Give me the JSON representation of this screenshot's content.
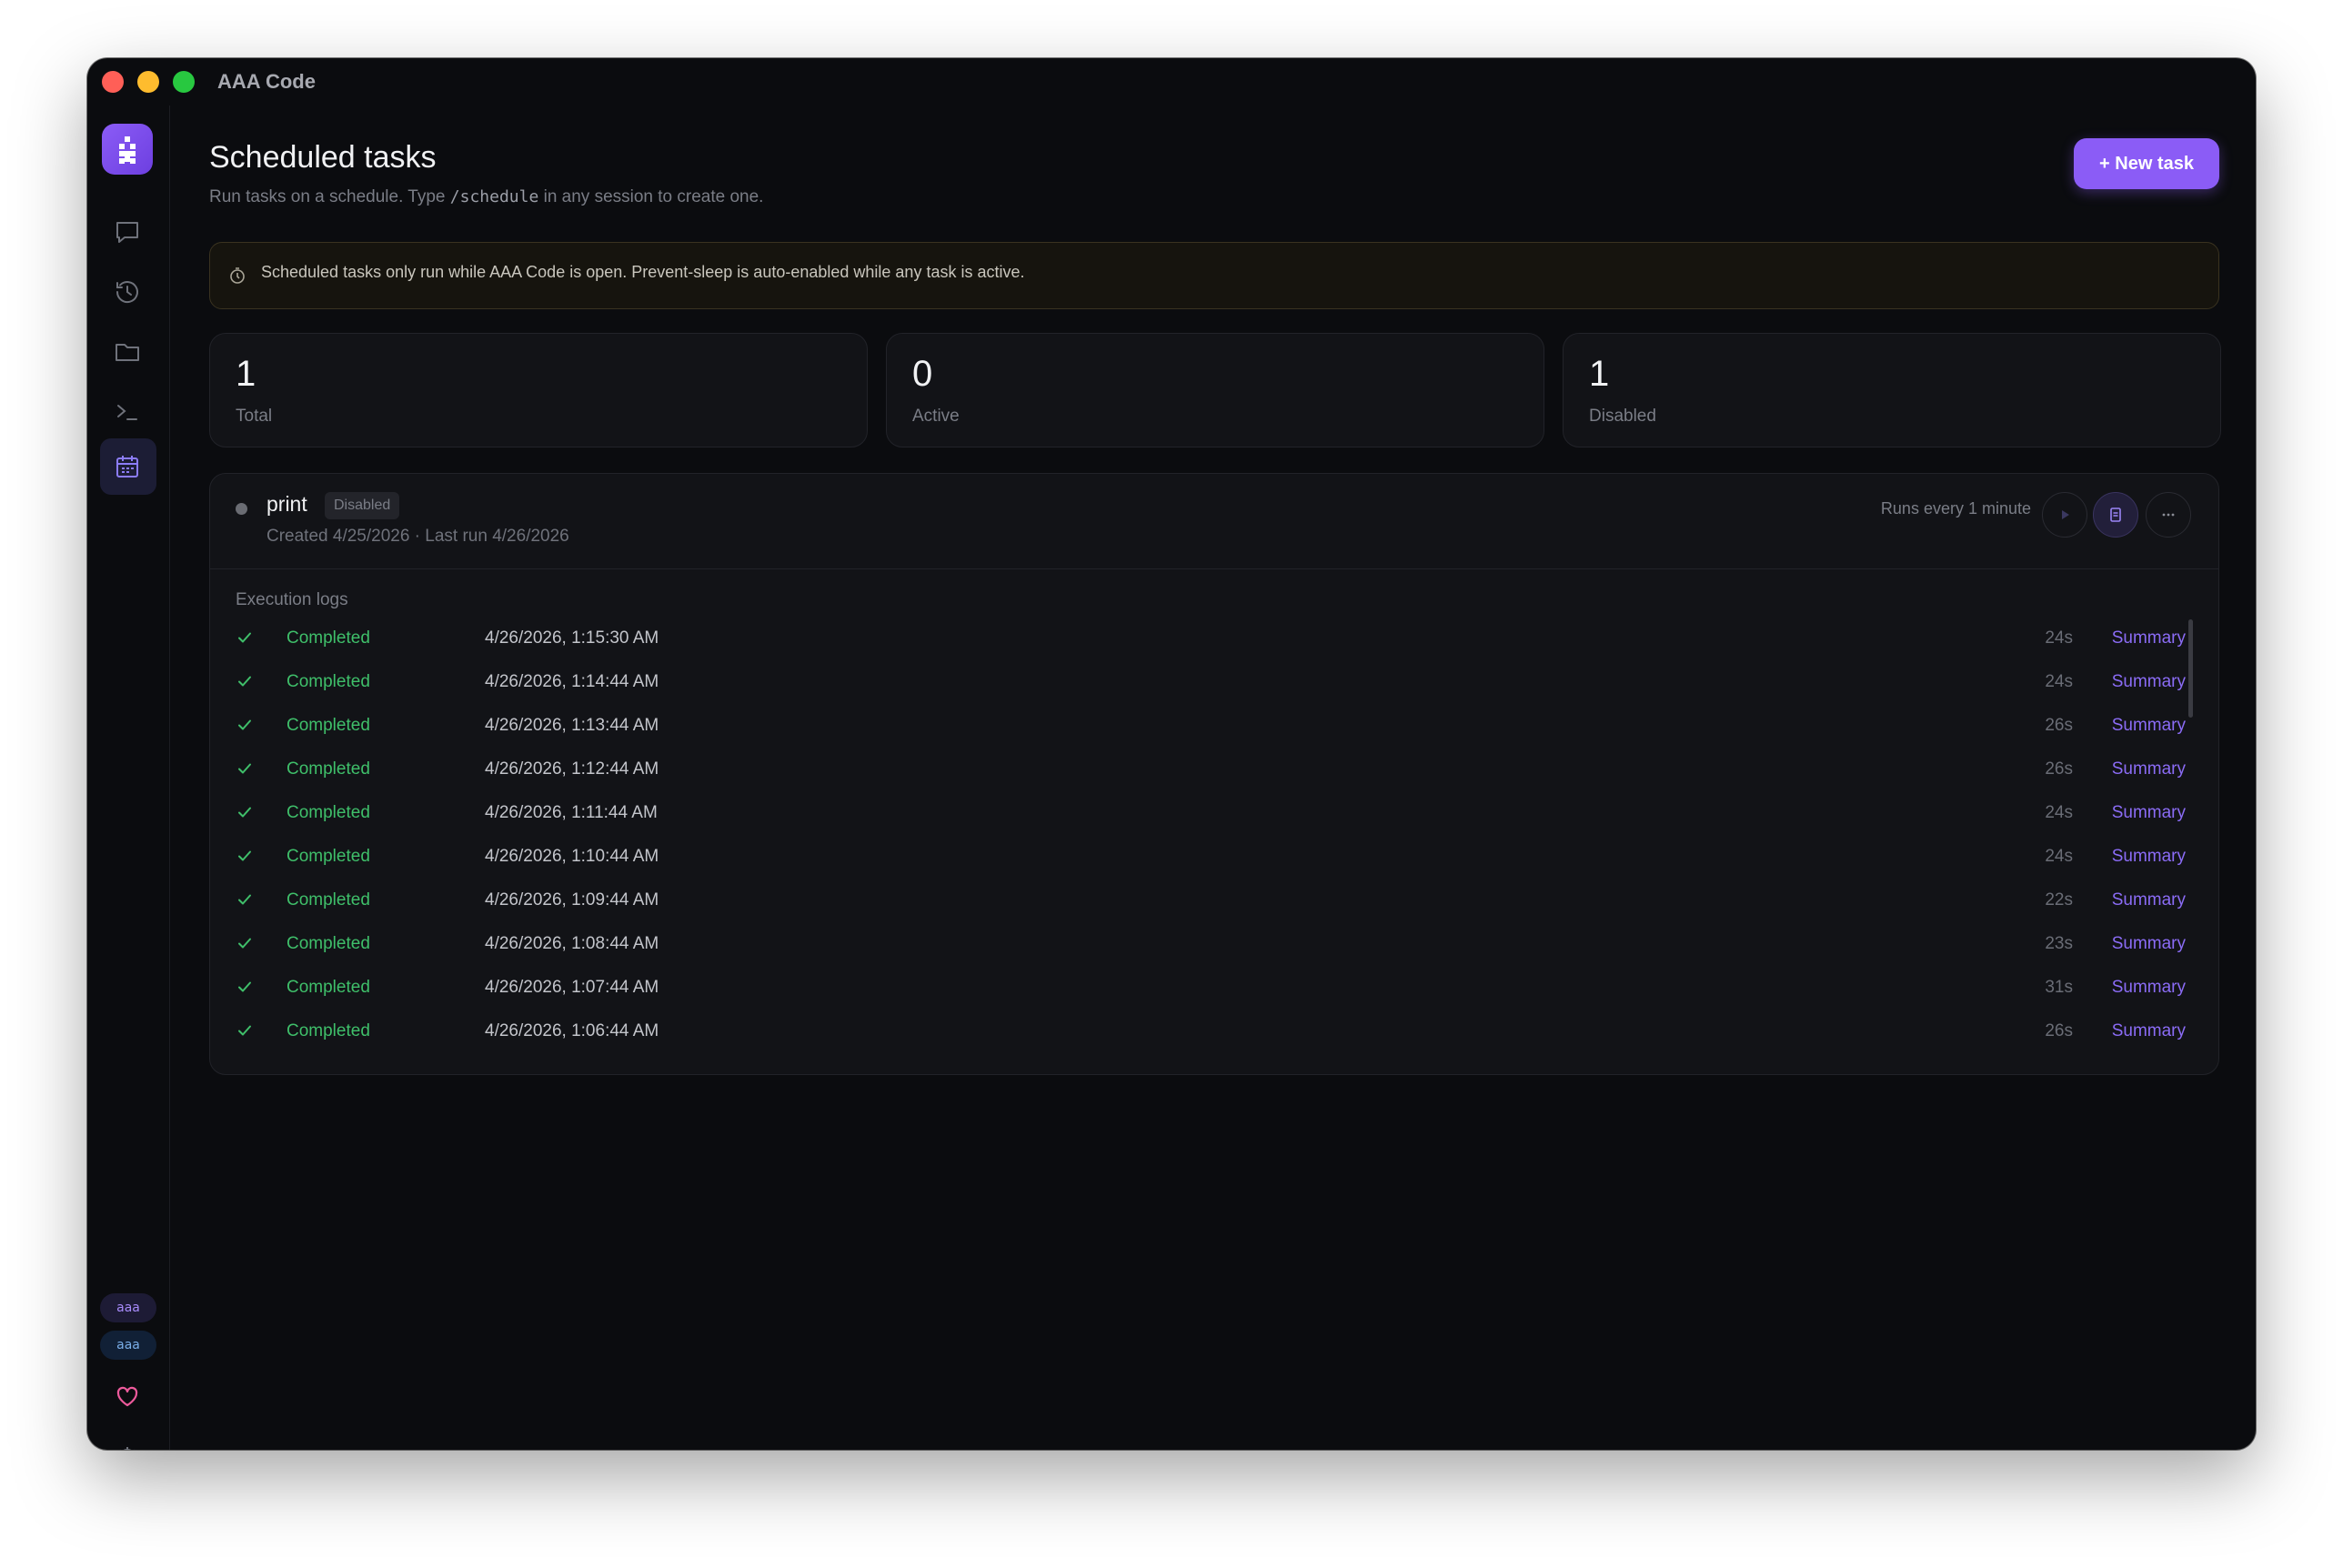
{
  "window": {
    "title": "AAA Code"
  },
  "sidebar": {
    "items": [
      "chat-icon",
      "history-icon",
      "folder-icon",
      "terminal-icon",
      "calendar-icon"
    ],
    "active": "calendar-icon",
    "pills": [
      "aaa",
      "aaa"
    ],
    "bottom": [
      "heart-icon",
      "gear-icon"
    ]
  },
  "header": {
    "title": "Scheduled tasks",
    "subtitle_pre": "Run tasks on a schedule. Type ",
    "subtitle_code": "/schedule",
    "subtitle_post": " in any session to create one.",
    "new_task": "+ New task"
  },
  "notice": {
    "text": "Scheduled tasks only run while AAA Code is open. Prevent-sleep is auto-enabled while any task is active."
  },
  "stats": [
    {
      "value": "1",
      "label": "Total"
    },
    {
      "value": "0",
      "label": "Active"
    },
    {
      "value": "1",
      "label": "Disabled"
    }
  ],
  "task": {
    "name": "print",
    "status": "Disabled",
    "meta": "Created 4/25/2026 · Last run 4/26/2026",
    "schedule": "Runs every 1 minute",
    "logs_title": "Execution logs",
    "logs": [
      {
        "status": "Completed",
        "time": "4/26/2026, 1:15:30 AM",
        "duration": "24s",
        "action": "Summary"
      },
      {
        "status": "Completed",
        "time": "4/26/2026, 1:14:44 AM",
        "duration": "24s",
        "action": "Summary"
      },
      {
        "status": "Completed",
        "time": "4/26/2026, 1:13:44 AM",
        "duration": "26s",
        "action": "Summary"
      },
      {
        "status": "Completed",
        "time": "4/26/2026, 1:12:44 AM",
        "duration": "26s",
        "action": "Summary"
      },
      {
        "status": "Completed",
        "time": "4/26/2026, 1:11:44 AM",
        "duration": "24s",
        "action": "Summary"
      },
      {
        "status": "Completed",
        "time": "4/26/2026, 1:10:44 AM",
        "duration": "24s",
        "action": "Summary"
      },
      {
        "status": "Completed",
        "time": "4/26/2026, 1:09:44 AM",
        "duration": "22s",
        "action": "Summary"
      },
      {
        "status": "Completed",
        "time": "4/26/2026, 1:08:44 AM",
        "duration": "23s",
        "action": "Summary"
      },
      {
        "status": "Completed",
        "time": "4/26/2026, 1:07:44 AM",
        "duration": "31s",
        "action": "Summary"
      },
      {
        "status": "Completed",
        "time": "4/26/2026, 1:06:44 AM",
        "duration": "26s",
        "action": "Summary"
      }
    ]
  },
  "colors": {
    "accent": "#8b5cf6",
    "success": "#3fbf6a",
    "background": "#0b0c0f"
  }
}
